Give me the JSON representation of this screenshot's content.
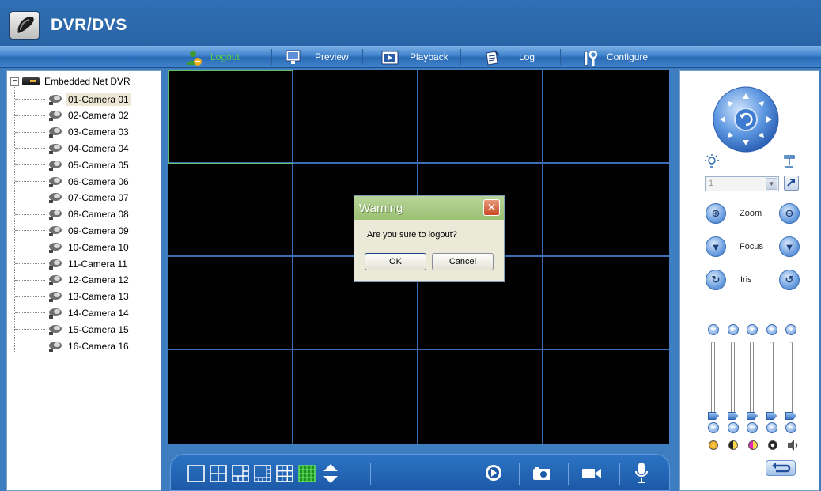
{
  "app": {
    "title": "DVR/DVS"
  },
  "nav": [
    {
      "label": "Logout",
      "icon": "logout-user-icon",
      "active": true
    },
    {
      "label": "Preview",
      "icon": "monitor-icon",
      "active": false
    },
    {
      "label": "Playback",
      "icon": "film-icon",
      "active": false
    },
    {
      "label": "Log",
      "icon": "notepad-icon",
      "active": false
    },
    {
      "label": "Configure",
      "icon": "wrench-icon",
      "active": false
    }
  ],
  "tree": {
    "root_label": "Embedded Net DVR",
    "expander": "−",
    "cameras": [
      "01-Camera 01",
      "02-Camera 02",
      "03-Camera 03",
      "04-Camera 04",
      "05-Camera 05",
      "06-Camera 06",
      "07-Camera 07",
      "08-Camera 08",
      "09-Camera 09",
      "10-Camera 10",
      "11-Camera 11",
      "12-Camera 12",
      "13-Camera 13",
      "14-Camera 14",
      "15-Camera 15",
      "16-Camera 16"
    ],
    "selected_index": 0
  },
  "grid": {
    "rows": 4,
    "cols": 4,
    "active_cell": 0
  },
  "ptz": {
    "preset_value": "1",
    "zoom_label": "Zoom",
    "focus_label": "Focus",
    "iris_label": "Iris"
  },
  "dialog": {
    "title": "Warning",
    "close_glyph": "✕",
    "message": "Are you sure to logout?",
    "ok_label": "OK",
    "cancel_label": "Cancel"
  },
  "colors": {
    "header_bg": "#2f6fb4",
    "grid_line": "#3d6db3",
    "active_cell": "#66c266",
    "nav_active": "#53d24b"
  }
}
